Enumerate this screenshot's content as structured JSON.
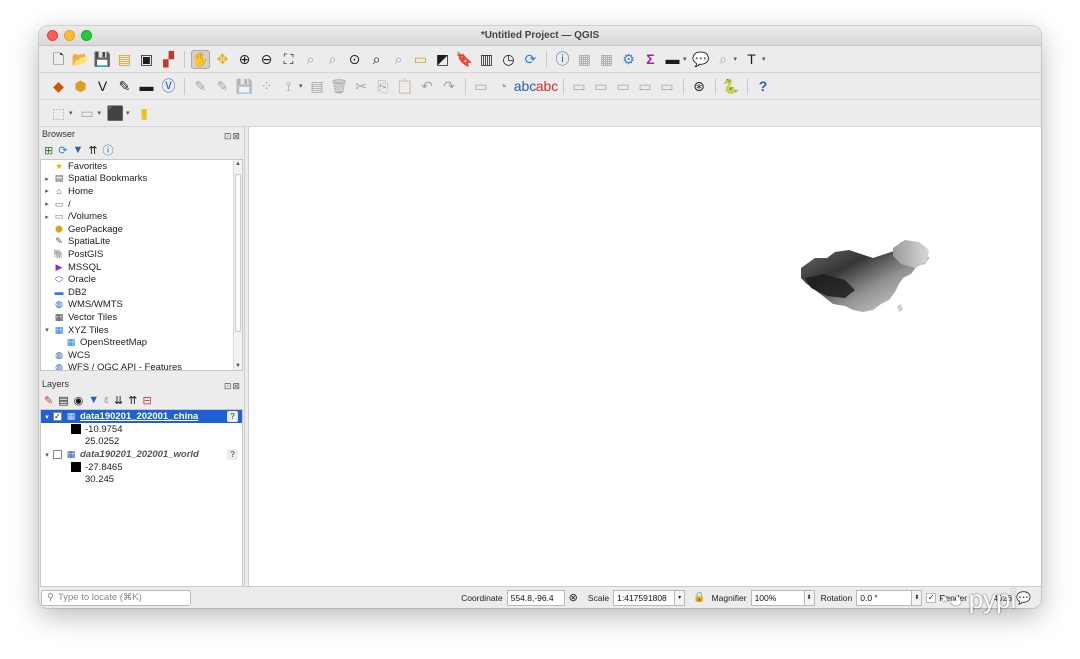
{
  "window": {
    "title": "*Untitled Project — QGIS"
  },
  "browser": {
    "title": "Browser",
    "items": [
      {
        "label": "Favorites",
        "icon": "star-icon",
        "arrow": ""
      },
      {
        "label": "Spatial Bookmarks",
        "icon": "bookmark-icon",
        "arrow": "▸"
      },
      {
        "label": "Home",
        "icon": "home-icon",
        "arrow": "▸"
      },
      {
        "label": "/",
        "icon": "folder-icon",
        "arrow": "▸"
      },
      {
        "label": "/Volumes",
        "icon": "folder-icon",
        "arrow": "▸"
      },
      {
        "label": "GeoPackage",
        "icon": "geopackage-icon",
        "arrow": ""
      },
      {
        "label": "SpatiaLite",
        "icon": "spatialite-icon",
        "arrow": ""
      },
      {
        "label": "PostGIS",
        "icon": "postgis-icon",
        "arrow": ""
      },
      {
        "label": "MSSQL",
        "icon": "mssql-icon",
        "arrow": ""
      },
      {
        "label": "Oracle",
        "icon": "oracle-icon",
        "arrow": ""
      },
      {
        "label": "DB2",
        "icon": "db2-icon",
        "arrow": ""
      },
      {
        "label": "WMS/WMTS",
        "icon": "wms-icon",
        "arrow": ""
      },
      {
        "label": "Vector Tiles",
        "icon": "vector-tiles-icon",
        "arrow": ""
      },
      {
        "label": "XYZ Tiles",
        "icon": "xyz-tiles-icon",
        "arrow": "▾"
      },
      {
        "label": "OpenStreetMap",
        "icon": "xyz-tiles-icon",
        "arrow": "",
        "indent": true
      },
      {
        "label": "WCS",
        "icon": "wcs-icon",
        "arrow": ""
      },
      {
        "label": "WFS / OGC API - Features",
        "icon": "wfs-icon",
        "arrow": ""
      }
    ]
  },
  "layers": {
    "title": "Layers",
    "items": [
      {
        "name": "data190201_202001_china",
        "checked": true,
        "selected": true,
        "min": "-10.9754",
        "max": "25.0252"
      },
      {
        "name": "data190201_202001_world",
        "checked": false,
        "selected": false,
        "min": "-27.8465",
        "max": "30.245"
      }
    ]
  },
  "status": {
    "locate_placeholder": "Type to locate (⌘K)",
    "coordinate_label": "Coordinate",
    "coordinate_value": "554.8,-96.4",
    "scale_label": "Scale",
    "scale_value": "1:417591808",
    "magnifier_label": "Magnifier",
    "magnifier_value": "100%",
    "rotation_label": "Rotation",
    "rotation_value": "0.0 °",
    "render_label": "Render",
    "crs_value": "4326"
  },
  "watermark": {
    "text": "pypi"
  },
  "colors": {
    "selection": "#1f61d4",
    "canvas": "#ffffff"
  }
}
